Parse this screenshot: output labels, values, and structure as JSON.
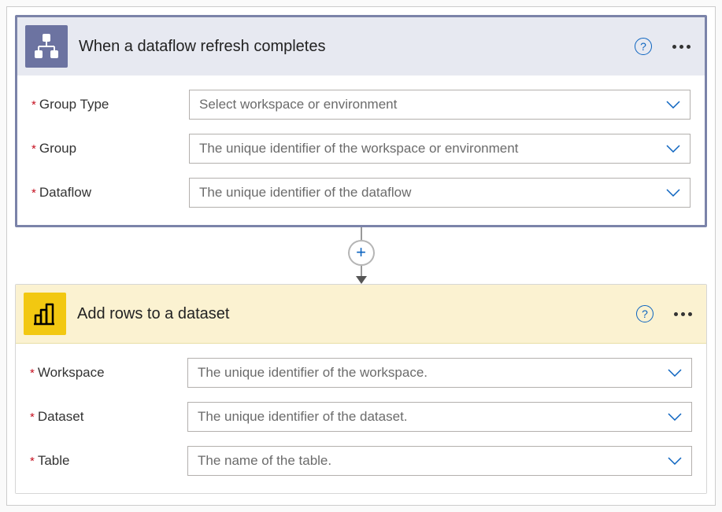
{
  "trigger": {
    "title": "When a dataflow refresh completes",
    "fields": [
      {
        "label": "Group Type",
        "placeholder": "Select workspace or environment"
      },
      {
        "label": "Group",
        "placeholder": "The unique identifier of the workspace or environment"
      },
      {
        "label": "Dataflow",
        "placeholder": "The unique identifier of the dataflow"
      }
    ]
  },
  "action": {
    "title": "Add rows to a dataset",
    "fields": [
      {
        "label": "Workspace",
        "placeholder": "The unique identifier of the workspace."
      },
      {
        "label": "Dataset",
        "placeholder": "The unique identifier of the dataset."
      },
      {
        "label": "Table",
        "placeholder": "The name of the table."
      }
    ]
  }
}
